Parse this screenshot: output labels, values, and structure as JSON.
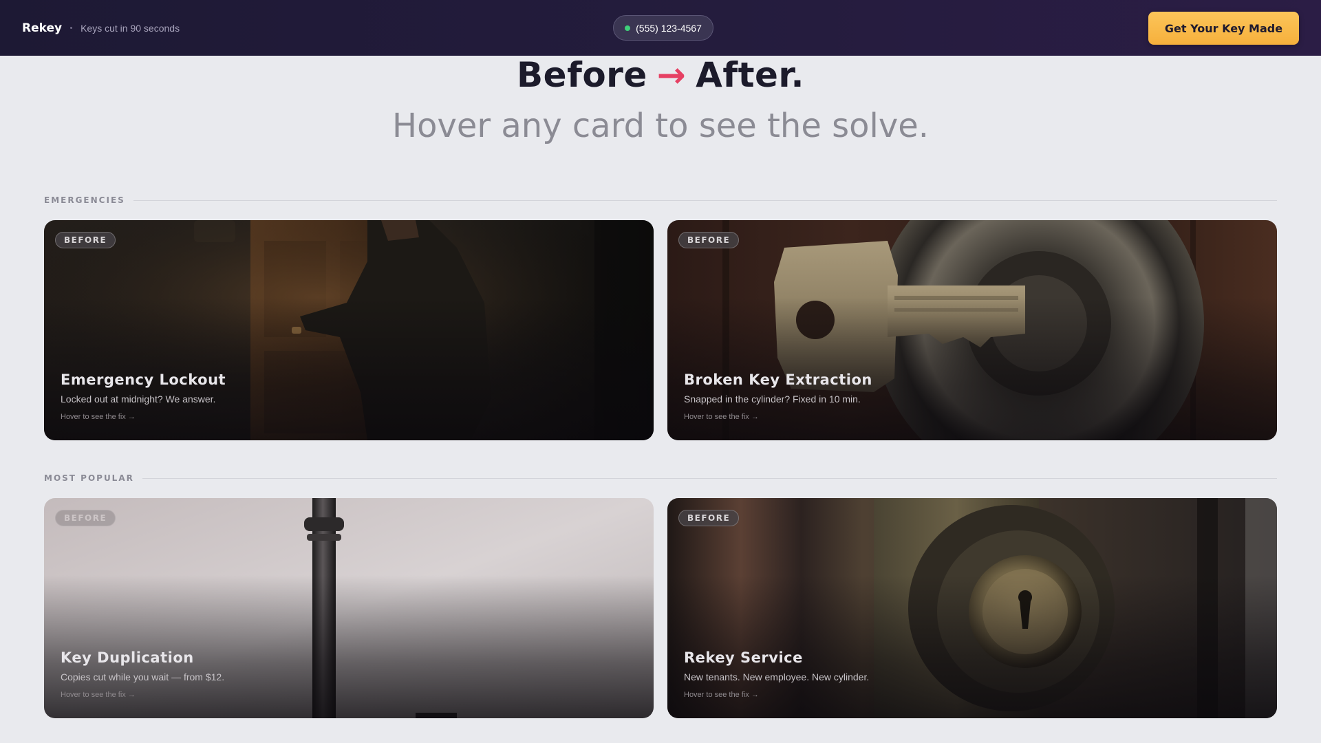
{
  "header": {
    "brand": "Rekey",
    "tagline": "Keys cut in 90 seconds",
    "phone": "(555) 123-4567",
    "cta_label": "Get Your Key Made"
  },
  "hero": {
    "title_before": "Before",
    "title_arrow": "→",
    "title_after": "After.",
    "subtitle": "Hover any card to see the solve."
  },
  "sections": [
    {
      "label": "EMERGENCIES",
      "cards": [
        {
          "badge": "BEFORE",
          "title": "Emergency Lockout",
          "description": "Locked out at midnight? We answer.",
          "hint": "Hover to see the fix →",
          "image_icon": "man-at-door"
        },
        {
          "badge": "BEFORE",
          "title": "Broken Key Extraction",
          "description": "Snapped in the cylinder? Fixed in 10 min.",
          "hint": "Hover to see the fix →",
          "image_icon": "key-in-lock"
        }
      ]
    },
    {
      "label": "MOST POPULAR",
      "cards": [
        {
          "badge": "BEFORE",
          "title": "Key Duplication",
          "description": "Copies cut while you wait — from $12.",
          "hint": "Hover to see the fix →",
          "image_icon": "skeleton-key"
        },
        {
          "badge": "BEFORE",
          "title": "Rekey Service",
          "description": "New tenants. New employee. New cylinder.",
          "hint": "Hover to see the fix →",
          "image_icon": "worn-doorknob"
        }
      ]
    }
  ],
  "colors": {
    "accent_arrow": "#e64063",
    "cta": "#f6b03c",
    "status_online": "#3fd07a",
    "nav_bg": "#241c3d",
    "page_bg": "#e9eaee"
  }
}
